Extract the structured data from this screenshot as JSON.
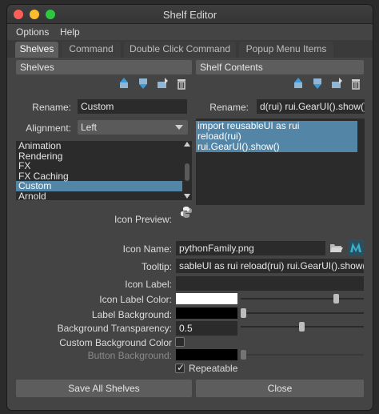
{
  "window": {
    "title": "Shelf Editor"
  },
  "menubar": {
    "items": [
      "Options",
      "Help"
    ]
  },
  "tabs": [
    "Shelves",
    "Command",
    "Double Click Command",
    "Popup Menu Items"
  ],
  "left_panel": {
    "header": "Shelves",
    "rename_label": "Rename:",
    "rename_value": "Custom",
    "alignment_label": "Alignment:",
    "alignment_value": "Left",
    "shelves": [
      "Animation",
      "Rendering",
      "FX",
      "FX Caching",
      "Custom",
      "Arnold"
    ],
    "selected_shelf": "Custom"
  },
  "right_panel": {
    "header": "Shelf Contents",
    "rename_label": "Rename:",
    "rename_value": "d(rui) rui.GearUI().show()",
    "script_lines": [
      "import reusableUI as rui",
      "reload(rui)",
      "rui.GearUI().show()"
    ]
  },
  "properties": {
    "icon_preview_label": "Icon Preview:",
    "icon_name_label": "Icon Name:",
    "icon_name_value": "pythonFamily.png",
    "tooltip_label": "Tooltip:",
    "tooltip_value": "sableUI as rui reload(rui) rui.GearUI().show()",
    "icon_label_label": "Icon Label:",
    "icon_label_value": "",
    "icon_label_color_label": "Icon Label Color:",
    "icon_label_color": "#ffffff",
    "label_background_label": "Label Background:",
    "label_background_color": "#000000",
    "background_transparency_label": "Background Transparency:",
    "background_transparency_value": "0.5",
    "custom_background_color_label": "Custom Background Color",
    "button_background_label": "Button Background:",
    "button_background_color": "#000000",
    "repeatable_label": "Repeatable",
    "repeatable_checked": true
  },
  "footer": {
    "save_label": "Save All Shelves",
    "close_label": "Close"
  },
  "colors": {
    "accent": "#5285a6",
    "panel": "#444444",
    "field": "#2b2b2b"
  },
  "icons": [
    "move-up-icon",
    "move-down-icon",
    "new-item-icon",
    "trash-icon",
    "python-icon",
    "folder-open-icon",
    "maya-logo-icon"
  ]
}
